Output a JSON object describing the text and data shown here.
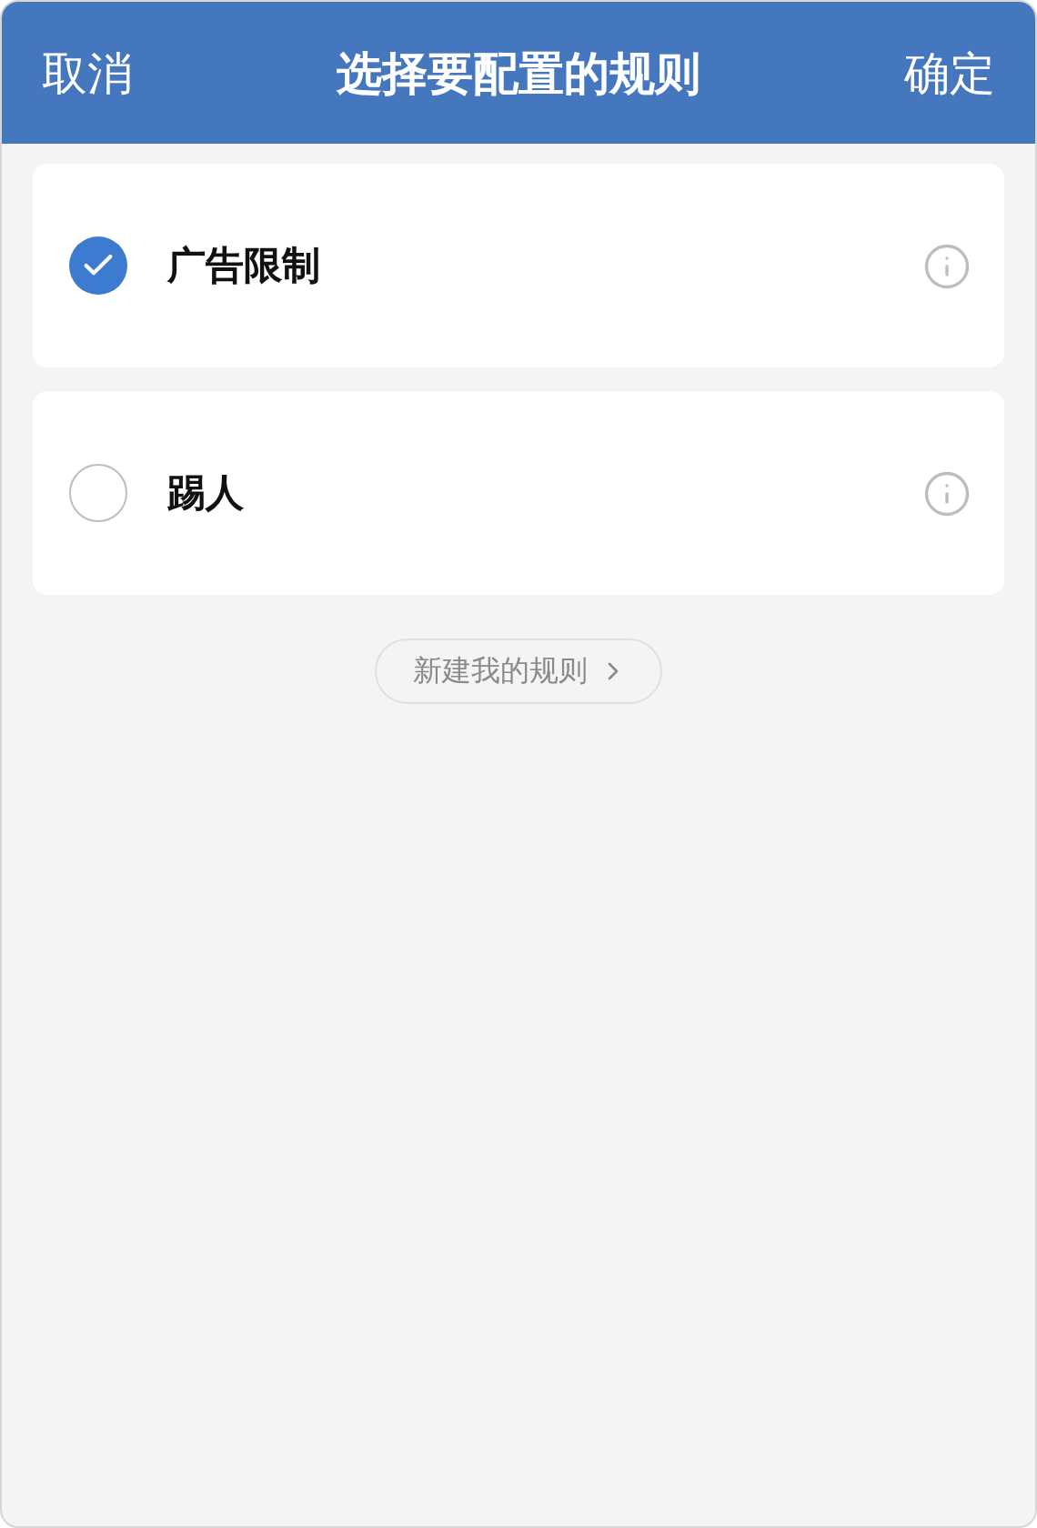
{
  "header": {
    "cancel": "取消",
    "title": "选择要配置的规则",
    "confirm": "确定"
  },
  "rules": [
    {
      "label": "广告限制",
      "selected": true
    },
    {
      "label": "踢人",
      "selected": false
    }
  ],
  "new_rule_button": "新建我的规则"
}
